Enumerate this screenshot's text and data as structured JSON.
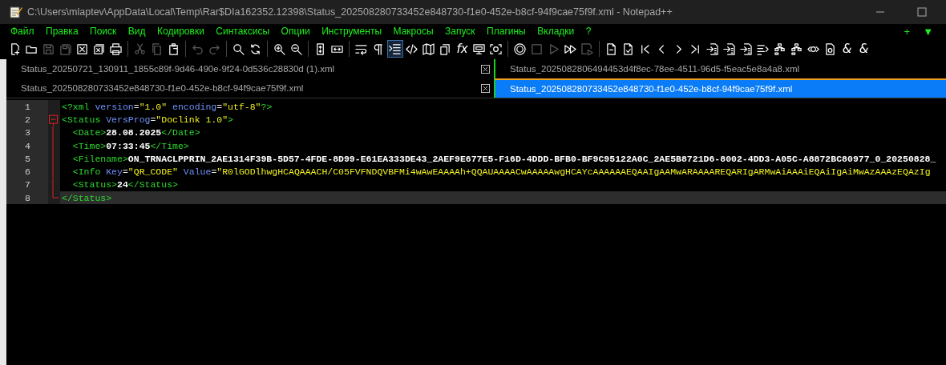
{
  "window": {
    "title": "C:\\Users\\mlaptev\\AppData\\Local\\Temp\\Rar$DIa162352.12398\\Status_202508280733452e848730-f1e0-452e-b8cf-94f9cae75f9f.xml - Notepad++"
  },
  "menu": [
    "Файл",
    "Правка",
    "Поиск",
    "Вид",
    "Кодировки",
    "Синтаксисы",
    "Опции",
    "Инструменты",
    "Макросы",
    "Запуск",
    "Плагины",
    "Вкладки",
    "?"
  ],
  "menu_right": [
    "+",
    "▼"
  ],
  "toolbar": [
    [
      {
        "kind": "new",
        "disabled": false,
        "on": false
      },
      {
        "kind": "open",
        "disabled": false,
        "on": false
      },
      {
        "kind": "save",
        "disabled": true,
        "on": false
      },
      {
        "kind": "saveall",
        "disabled": true,
        "on": false
      },
      {
        "kind": "close",
        "disabled": false,
        "on": false
      },
      {
        "kind": "closeall",
        "disabled": false,
        "on": false
      },
      {
        "kind": "print",
        "disabled": false,
        "on": false
      }
    ],
    [
      {
        "kind": "cut",
        "disabled": true,
        "on": false
      },
      {
        "kind": "copy",
        "disabled": true,
        "on": false
      },
      {
        "kind": "paste",
        "disabled": false,
        "on": false
      }
    ],
    [
      {
        "kind": "undo",
        "disabled": true,
        "on": false
      },
      {
        "kind": "redo",
        "disabled": true,
        "on": false
      }
    ],
    [
      {
        "kind": "find",
        "disabled": false,
        "on": false
      },
      {
        "kind": "replace",
        "disabled": false,
        "on": false
      }
    ],
    [
      {
        "kind": "zoomin",
        "disabled": false,
        "on": false
      },
      {
        "kind": "zoomout",
        "disabled": false,
        "on": false
      }
    ],
    [
      {
        "kind": "syncv",
        "disabled": false,
        "on": false
      },
      {
        "kind": "synch",
        "disabled": false,
        "on": false
      }
    ],
    [
      {
        "kind": "wrap",
        "disabled": false,
        "on": false
      },
      {
        "kind": "pilcrow",
        "disabled": false,
        "on": false
      },
      {
        "kind": "indent",
        "disabled": false,
        "on": true
      },
      {
        "kind": "xmltag",
        "disabled": false,
        "on": false
      },
      {
        "kind": "map",
        "disabled": false,
        "on": false
      },
      {
        "kind": "clone",
        "disabled": false,
        "on": false
      },
      {
        "kind": "glyph",
        "label": "fx",
        "disabled": false,
        "on": false
      },
      {
        "kind": "monitor",
        "disabled": false,
        "on": false
      },
      {
        "kind": "camera",
        "disabled": false,
        "on": false
      }
    ],
    [
      {
        "kind": "record",
        "disabled": false,
        "on": false
      },
      {
        "kind": "stop",
        "disabled": true,
        "on": false
      },
      {
        "kind": "play",
        "disabled": true,
        "on": false
      },
      {
        "kind": "playmulti",
        "disabled": false,
        "on": false
      },
      {
        "kind": "savemacro",
        "disabled": true,
        "on": false
      }
    ],
    [
      {
        "kind": "doc",
        "disabled": false,
        "on": false
      },
      {
        "kind": "doccheck",
        "disabled": false,
        "on": false
      },
      {
        "kind": "first",
        "disabled": false,
        "on": false
      },
      {
        "kind": "prev",
        "disabled": false,
        "on": false
      },
      {
        "kind": "next",
        "disabled": false,
        "on": false
      },
      {
        "kind": "last",
        "disabled": false,
        "on": false
      },
      {
        "kind": "import",
        "disabled": false,
        "on": false
      },
      {
        "kind": "import",
        "disabled": false,
        "on": false
      },
      {
        "kind": "import",
        "disabled": false,
        "on": false
      },
      {
        "kind": "list",
        "disabled": false,
        "on": false
      },
      {
        "kind": "tree",
        "disabled": false,
        "on": false
      },
      {
        "kind": "tree",
        "disabled": false,
        "on": false
      },
      {
        "kind": "gearcode",
        "disabled": false,
        "on": false
      },
      {
        "kind": "docgear",
        "disabled": false,
        "on": false
      },
      {
        "kind": "glyph",
        "label": "&",
        "disabled": false,
        "on": false
      },
      {
        "kind": "glyph",
        "label": "&",
        "disabled": false,
        "on": false
      }
    ]
  ],
  "tabs": [
    [
      {
        "label": "Status_20250721_130911_1855c89f-9d46-490e-9f24-0d536c28830d (1).xml",
        "selected": false,
        "close_button": true
      },
      {
        "label": "Status_2025082806494453d4f8ec-78ee-4511-96d5-f5eac5e8a4a8.xml",
        "selected": false,
        "close_button": false
      }
    ],
    [
      {
        "label": "Status_202508280733452e848730-f1e0-452e-b8cf-94f9cae75f9f.xml",
        "selected": false,
        "close_button": true
      },
      {
        "label": "Status_202508280733452e848730-f1e0-452e-b8cf-94f9cae75f9f.xml",
        "selected": true,
        "close_button": false
      }
    ]
  ],
  "editor": {
    "lines": [
      {
        "number": "1",
        "current": false,
        "kind": "plain",
        "tokens": [
          {
            "kind": "tag",
            "text": "<?xml "
          },
          {
            "kind": "attr",
            "text": "version"
          },
          {
            "kind": "eq",
            "text": "="
          },
          {
            "kind": "value",
            "text": "\"1.0\" "
          },
          {
            "kind": "attr",
            "text": "encoding"
          },
          {
            "kind": "eq",
            "text": "="
          },
          {
            "kind": "value",
            "text": "\"utf-8\""
          },
          {
            "kind": "tag",
            "text": "?>"
          }
        ]
      },
      {
        "number": "2",
        "current": false,
        "kind": "foldstart",
        "tokens": [
          {
            "kind": "tag",
            "text": "<Status "
          },
          {
            "kind": "attr",
            "text": "VersProg"
          },
          {
            "kind": "eq",
            "text": "="
          },
          {
            "kind": "value",
            "text": "\"Doclink 1.0\""
          },
          {
            "kind": "tag",
            "text": ">"
          }
        ]
      },
      {
        "number": "3",
        "current": false,
        "kind": "foldbody",
        "tokens": [
          {
            "kind": "tag",
            "text": "  <Date>"
          },
          {
            "kind": "text",
            "text": "28.08.2025"
          },
          {
            "kind": "tag",
            "text": "</Date>"
          }
        ]
      },
      {
        "number": "4",
        "current": false,
        "kind": "foldbody",
        "tokens": [
          {
            "kind": "tag",
            "text": "  <Time>"
          },
          {
            "kind": "text",
            "text": "07:33:45"
          },
          {
            "kind": "tag",
            "text": "</Time>"
          }
        ]
      },
      {
        "number": "5",
        "current": false,
        "kind": "foldbody",
        "tokens": [
          {
            "kind": "tag",
            "text": "  <Filename>"
          },
          {
            "kind": "text",
            "text": "ON_TRNACLPPRIN_2AE1314F39B-5D57-4FDE-8D99-E61EA333DE43_2AEF9E677E5-F16D-4DDD-BFB0-BF9C95122A0C_2AE5B8721D6-8002-4DD3-A05C-A8872BC80977_0_20250828_"
          }
        ]
      },
      {
        "number": "6",
        "current": false,
        "kind": "foldbody",
        "tokens": [
          {
            "kind": "tag",
            "text": "  <Info "
          },
          {
            "kind": "attr",
            "text": "Key"
          },
          {
            "kind": "eq",
            "text": "="
          },
          {
            "kind": "value",
            "text": "\"QR_CODE\" "
          },
          {
            "kind": "attr",
            "text": "Value"
          },
          {
            "kind": "eq",
            "text": "="
          },
          {
            "kind": "value",
            "text": "\"R0lGODlhwgHCAQAAACH/C05FVFNDQVBFMi4wAwEAAAAh+QQAUAAAACwAAAAAwgHCAYcAAAAAAEQAAIgAAMwARAAAAREQARIgARMwAiAAAiEQAiIgAiMwAzAAAzEQAzIg"
          }
        ]
      },
      {
        "number": "7",
        "current": false,
        "kind": "foldbody",
        "tokens": [
          {
            "kind": "tag",
            "text": "  <Status>"
          },
          {
            "kind": "text",
            "text": "24"
          },
          {
            "kind": "tag",
            "text": "</Status>"
          }
        ]
      },
      {
        "number": "8",
        "current": true,
        "kind": "foldend",
        "tokens": [
          {
            "kind": "tag",
            "text": "</Status>"
          }
        ]
      }
    ]
  }
}
